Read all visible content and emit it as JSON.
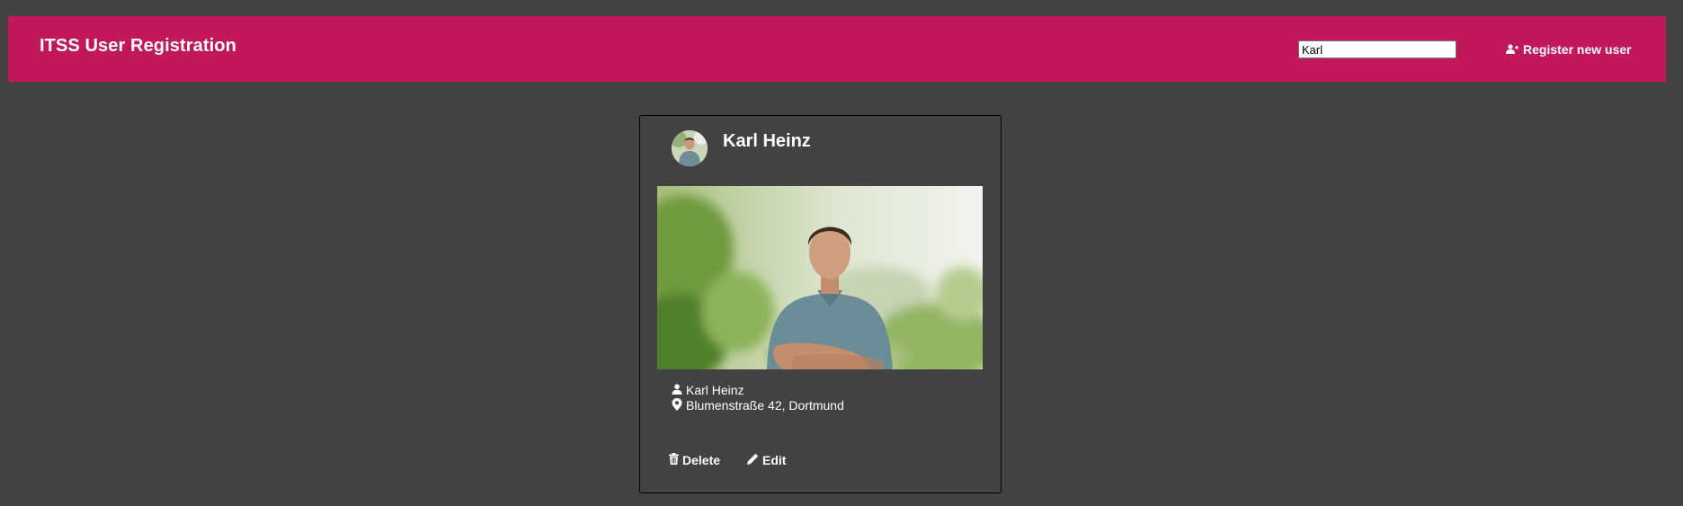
{
  "header": {
    "title": "ITSS User Registration",
    "search_value": "Karl",
    "register_label": "Register new user",
    "brand_color": "#c2185b"
  },
  "card": {
    "title": "Karl Heinz",
    "name": "Karl Heinz",
    "address": "Blumenstraße 42, Dortmund",
    "delete_label": "Delete",
    "edit_label": "Edit",
    "icons": [
      "user-icon",
      "map-pin-icon",
      "trash-icon",
      "pencil-icon",
      "user-plus-icon"
    ]
  }
}
